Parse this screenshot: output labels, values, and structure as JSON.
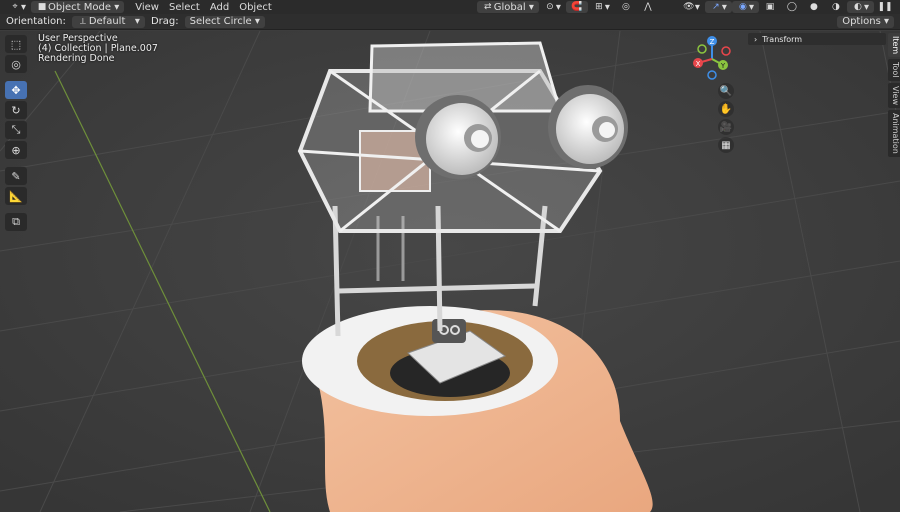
{
  "header": {
    "editor_icon": "3d-viewport-icon",
    "mode": "Object Mode",
    "menus": [
      "View",
      "Select",
      "Add",
      "Object"
    ],
    "transform_orientation": "Global",
    "options_label": "Options"
  },
  "toolbar": {
    "orientation_label": "Orientation:",
    "orientation_value": "Default",
    "drag_label": "Drag:",
    "drag_value": "Select Circle"
  },
  "viewport": {
    "perspective": "User Perspective",
    "collection": "(4) Collection | Plane.007",
    "status": "Rendering Done"
  },
  "sidebar": {
    "panel_title": "Transform",
    "tabs": [
      "Item",
      "Tool",
      "View",
      "Animation"
    ]
  },
  "gizmo": {
    "x": "X",
    "y": "Y",
    "z": "Z"
  },
  "colors": {
    "accent": "#4772b3",
    "x_axis": "#e8464b",
    "y_axis": "#8bc53f",
    "z_axis": "#3f8fe8"
  }
}
